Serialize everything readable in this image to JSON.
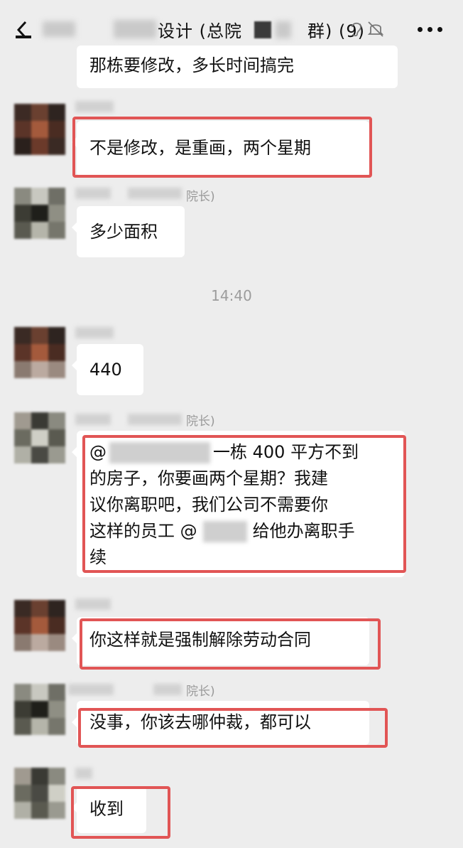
{
  "header": {
    "title_part1": "设计 (总院",
    "title_part2": "群) (9)",
    "icons": {
      "back": "back-icon",
      "ear": "ear-icon",
      "mute": "mute-icon",
      "more": "more-icon"
    }
  },
  "role_label": "院长)",
  "time_label": "14:40",
  "messages": {
    "m1": "那栋要修改，多长时间搞完",
    "m2": "不是修改，是重画，两个星期",
    "m3": "多少面积",
    "m4": "440",
    "m5_at": "@",
    "m5_line1_rest": "一栋 400 平方不到",
    "m5_line2": "的房子，你要画两个星期？我建",
    "m5_line3": "议你离职吧，我们公司不需要你",
    "m5_line4a": "这样的员工 @",
    "m5_line4b": "给他办离职手",
    "m5_line5": "续",
    "m6": "你这样就是强制解除劳动合同",
    "m7": "没事，你该去哪仲裁，都可以",
    "m8": "收到"
  },
  "colors": {
    "background": "#ededed",
    "bubble": "#ffffff",
    "highlight": "#e15555",
    "meta_text": "#999999"
  }
}
